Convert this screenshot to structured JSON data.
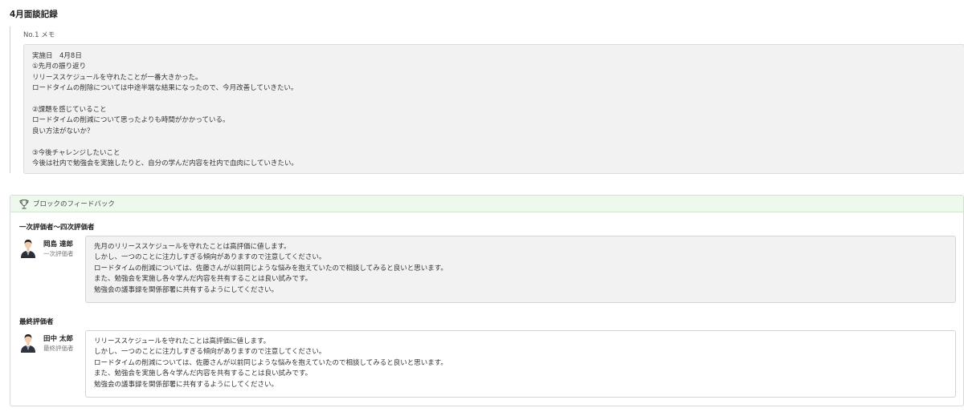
{
  "page": {
    "title": "4月面談記録"
  },
  "memo": {
    "label": "No.1  メモ",
    "lines": [
      "実施日　4月8日",
      "①先月の振り返り",
      "リリーススケジュールを守れたことが一番大きかった。",
      "ロードタイムの削除については中途半端な結果になったので、今月改善していきたい。",
      "",
      "②課題を感じていること",
      "ロードタイムの削減について思ったよりも時間がかかっている。",
      "良い方法がないか？",
      "",
      "③今後チャレンジしたいこと",
      "今後は社内で勉強会を実施したりと、自分の学んだ内容を社内で血肉にしていきたい。"
    ]
  },
  "feedback": {
    "header_title": "ブロックのフィードバック",
    "header_icon": "trophy-icon",
    "groups": [
      {
        "label": "一次評価者〜四次評価者",
        "evaluator": {
          "name": "岡島 達郎",
          "role": "一次評価者",
          "avatar": "avatar-man-dark-suit"
        },
        "comment": [
          "先月のリリーススケジュールを守れたことは高評価に値します。",
          "しかし、一つのことに注力しすぎる傾向がありますので注意してください。",
          "ロードタイムの削減については、佐藤さんが以前同じような悩みを抱えていたので相談してみると良いと思います。",
          "また、勉強会を実施し各々学んだ内容を共有することは良い試みです。",
          "勉強会の議事録を関係部署に共有するようにしてください。"
        ]
      },
      {
        "label": "最終評価者",
        "evaluator": {
          "name": "田中 太郎",
          "role": "最終評価者",
          "avatar": "avatar-man-dark-suit"
        },
        "comment": [
          "リリーススケジュールを守れたことは高評価に値します。",
          "しかし、一つのことに注力しすぎる傾向がありますので注意してください。",
          "ロードタイムの削減については、佐藤さんが以前同じような悩みを抱えていたので相談してみると良いと思います。",
          "また、勉強会を実施し各々学んだ内容を共有することは良い試みです。",
          "勉強会の議事録を関係部署に共有するようにしてください。"
        ]
      }
    ]
  },
  "colors": {
    "header_bg": "#eef9ee",
    "memo_bg": "#f2f2f2",
    "border": "#d4d4d4"
  }
}
